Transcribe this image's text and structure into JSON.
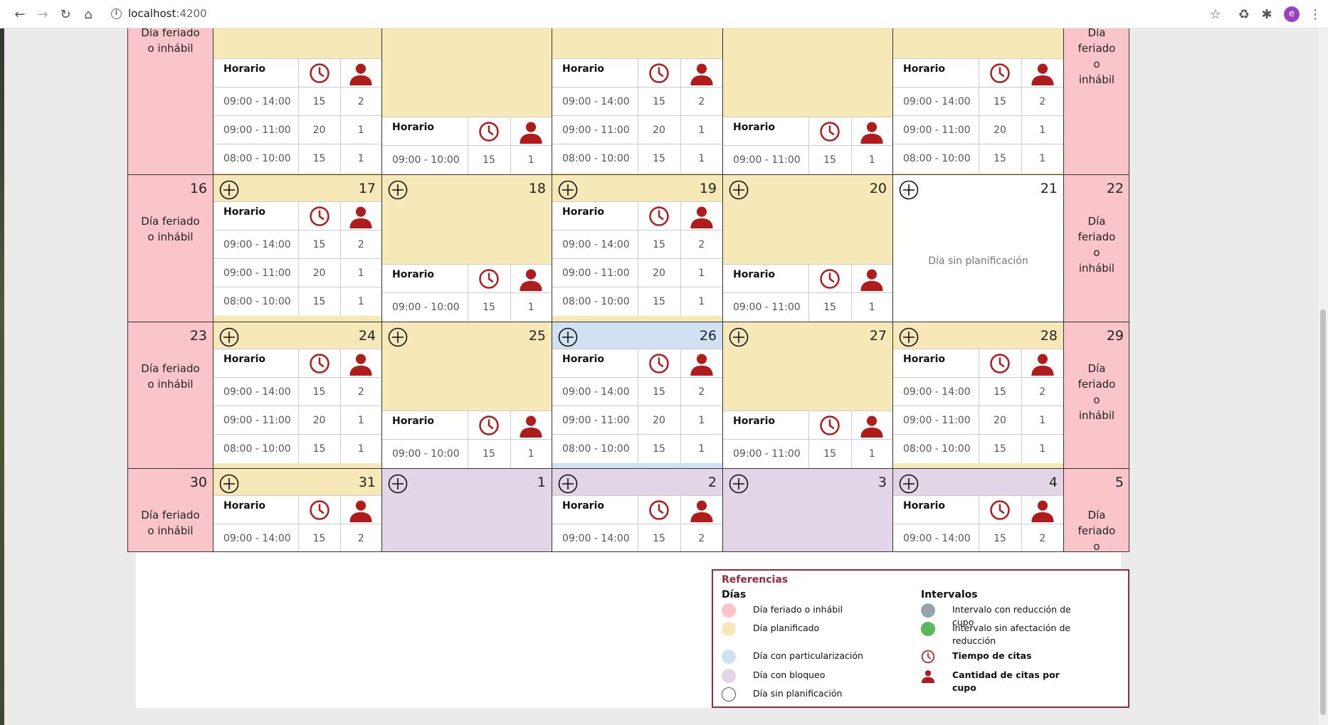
{
  "browser": {
    "url_host": "localhost",
    "url_port": ":4200",
    "profile_initial": "e"
  },
  "labels": {
    "holiday": "Día feriado o inhábil",
    "no_plan": "Día sin planificación",
    "horario": "Horario"
  },
  "schedules": {
    "A": [
      [
        "09:00 - 14:00",
        "15",
        "2"
      ],
      [
        "09:00 - 11:00",
        "20",
        "1"
      ],
      [
        "08:00 - 10:00",
        "15",
        "1"
      ]
    ],
    "B": [
      [
        "09:00 - 10:00",
        "15",
        "1"
      ]
    ],
    "C": [
      [
        "08:00 - 10:00",
        "20",
        "1"
      ],
      [
        "09:00 - 11:00",
        "15",
        "1"
      ]
    ],
    "D": [
      [
        "09:00 - 11:00",
        "15",
        "1"
      ]
    ]
  },
  "calendar": {
    "weeks": [
      [
        {
          "day": "",
          "status": "holiday",
          "partial_top": true
        },
        {
          "day": "",
          "status": "planned",
          "sched": "A",
          "partial_top": true
        },
        {
          "day": "",
          "status": "planned",
          "sched": "B",
          "partial_top": true
        },
        {
          "day": "",
          "status": "planned",
          "sched": "A",
          "partial_top": true
        },
        {
          "day": "",
          "status": "planned",
          "sched": "D",
          "partial_top": true
        },
        {
          "day": "",
          "status": "planned",
          "sched": "A",
          "partial_top": true
        },
        {
          "day": "",
          "status": "holiday",
          "partial_top": true
        }
      ],
      [
        {
          "day": "16",
          "status": "holiday"
        },
        {
          "day": "17",
          "status": "planned",
          "sched": "A"
        },
        {
          "day": "18",
          "status": "planned",
          "sched": "B"
        },
        {
          "day": "19",
          "status": "planned",
          "sched": "A"
        },
        {
          "day": "20",
          "status": "planned",
          "sched": "D"
        },
        {
          "day": "21",
          "status": "none"
        },
        {
          "day": "22",
          "status": "holiday"
        }
      ],
      [
        {
          "day": "23",
          "status": "holiday"
        },
        {
          "day": "24",
          "status": "planned",
          "sched": "A"
        },
        {
          "day": "25",
          "status": "planned",
          "sched": "B"
        },
        {
          "day": "26",
          "status": "particular",
          "sched": "A"
        },
        {
          "day": "27",
          "status": "planned",
          "sched": "D"
        },
        {
          "day": "28",
          "status": "planned",
          "sched": "A"
        },
        {
          "day": "29",
          "status": "holiday"
        }
      ],
      [
        {
          "day": "30",
          "status": "holiday"
        },
        {
          "day": "31",
          "status": "planned",
          "sched": "A"
        },
        {
          "day": "1",
          "status": "blocked",
          "sched": "B"
        },
        {
          "day": "2",
          "status": "blocked",
          "sched": "A"
        },
        {
          "day": "3",
          "status": "blocked",
          "sched": "D"
        },
        {
          "day": "4",
          "status": "blocked",
          "sched": "A"
        },
        {
          "day": "5",
          "status": "holiday"
        }
      ]
    ]
  },
  "legend": {
    "title": "Referencias",
    "days_heading": "Días",
    "intervals_heading": "Intervalos",
    "days": [
      {
        "label": "Día feriado o inhábil",
        "color": "#f9c5ca"
      },
      {
        "label": "Día planificado",
        "color": "#f7e8b8"
      },
      {
        "label": "Día con particularización",
        "color": "#cfe1f3"
      },
      {
        "label": "Día con bloqueo",
        "color": "#e2d5e8"
      },
      {
        "label": "Día sin planificación",
        "color": "#ffffff"
      }
    ],
    "intervals": [
      {
        "label": "Intervalo con reducción de cupo",
        "kind": "dot",
        "color": "#9aa3ad"
      },
      {
        "label": "Intervalo sin afectación de reducción",
        "kind": "dot",
        "color": "#5cb85c"
      },
      {
        "label": "Tiempo de citas",
        "kind": "clock-icon",
        "bold": true
      },
      {
        "label": "Cantidad de citas por cupo",
        "kind": "user-icon",
        "bold": true
      }
    ]
  },
  "colors": {
    "accent": "#b01c1c",
    "legend_border": "#9a2a3a"
  }
}
